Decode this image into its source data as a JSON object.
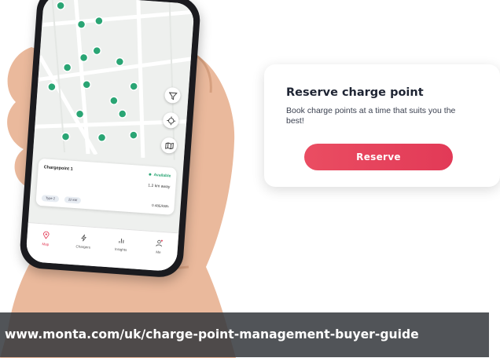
{
  "phone": {
    "chargepoint": {
      "name": "Chargepoint 1",
      "status": "Available",
      "distance": "1.2 km away",
      "tags": [
        "Type 2",
        "22 kW"
      ],
      "price": "0.48£/kWh"
    },
    "tabs": [
      {
        "label": "Map",
        "icon": "map-pin-icon",
        "active": true
      },
      {
        "label": "Chargers",
        "icon": "lightning-icon",
        "active": false
      },
      {
        "label": "Insights",
        "icon": "bar-chart-icon",
        "active": false
      },
      {
        "label": "Me",
        "icon": "user-icon",
        "active": false
      }
    ],
    "map_buttons": [
      "filter-icon",
      "locate-icon",
      "map-layers-icon"
    ]
  },
  "reserve": {
    "title": "Reserve charge point",
    "description": "Book charge points at a time that suits you the best!",
    "button_label": "Reserve"
  },
  "banner": {
    "url": "www.monta.com/uk/charge-point-management-buyer-guide"
  },
  "colors": {
    "accent": "#e23a57",
    "marker": "#2aa574",
    "banner": "#34383c"
  }
}
